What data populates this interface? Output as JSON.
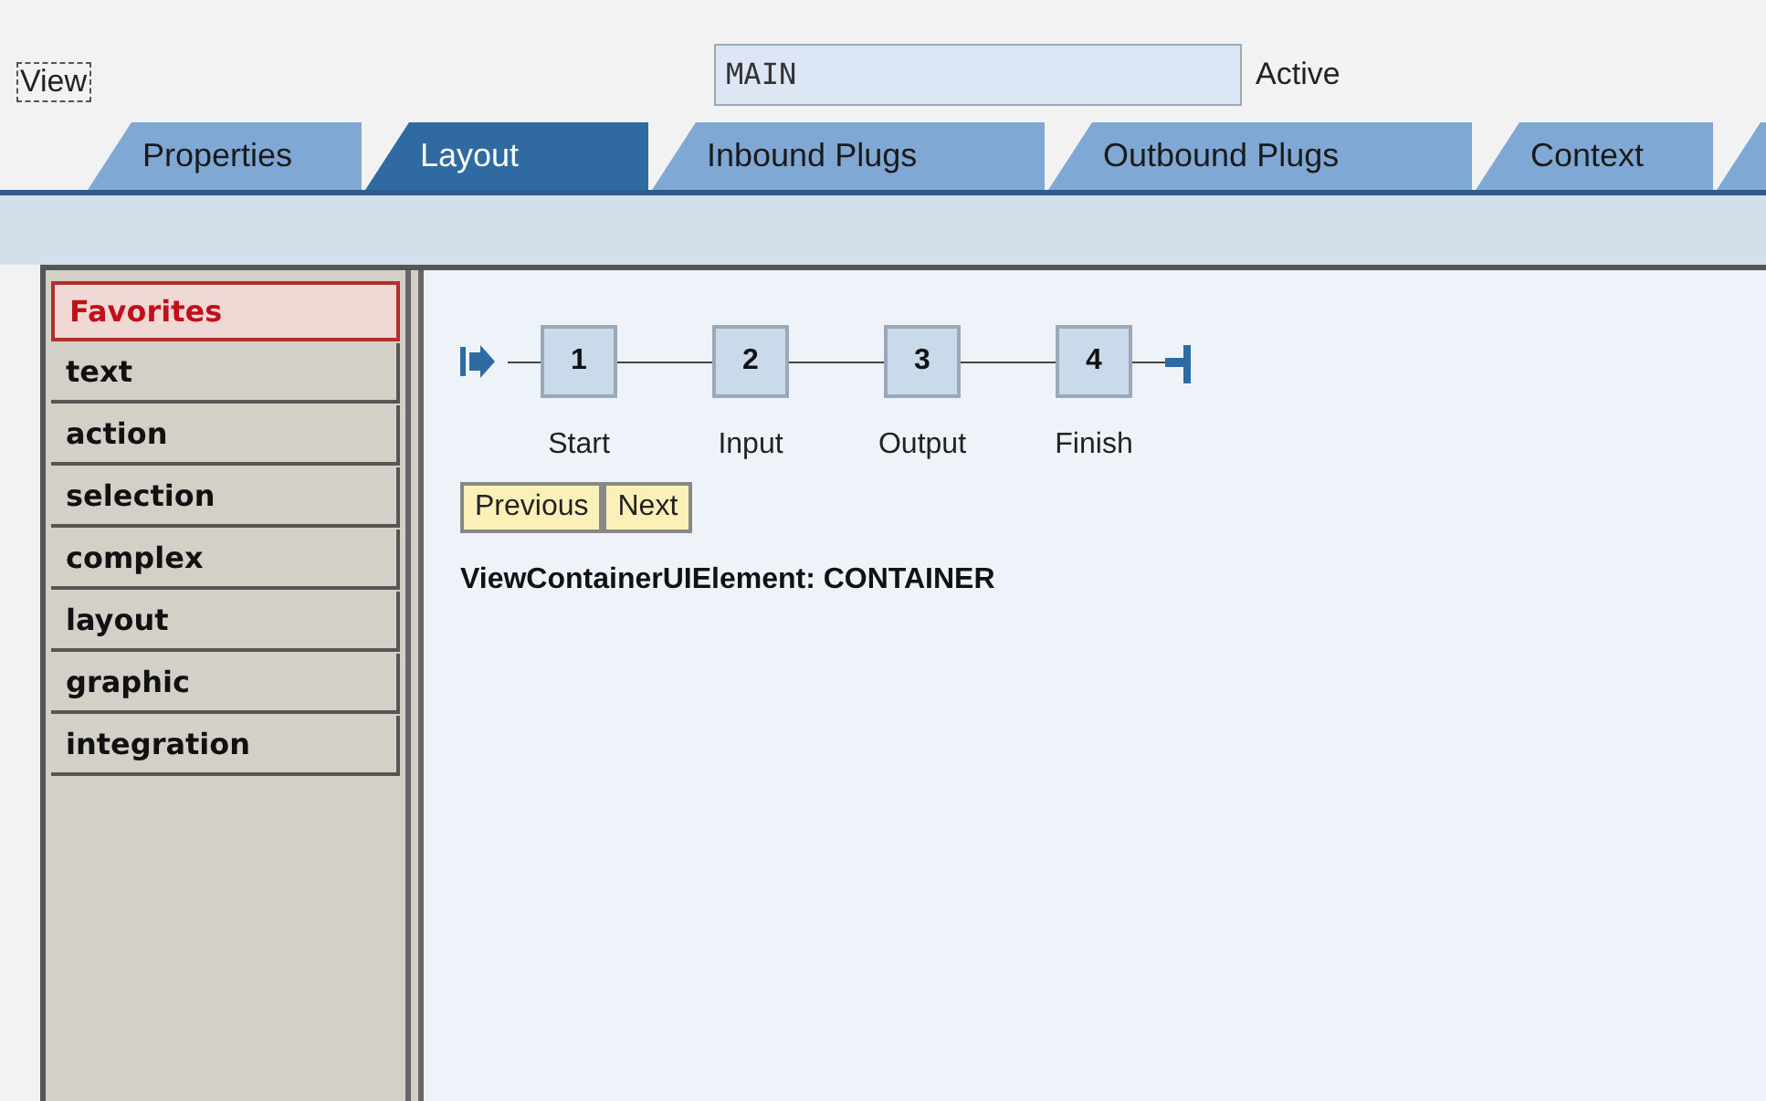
{
  "header": {
    "label": "View",
    "name_value": "MAIN",
    "status": "Active"
  },
  "tabs": [
    {
      "label": "Properties",
      "selected": false
    },
    {
      "label": "Layout",
      "selected": true
    },
    {
      "label": "Inbound Plugs",
      "selected": false
    },
    {
      "label": "Outbound Plugs",
      "selected": false
    },
    {
      "label": "Context",
      "selected": false
    }
  ],
  "palette": [
    {
      "label": "Favorites",
      "selected": true
    },
    {
      "label": "text",
      "selected": false
    },
    {
      "label": "action",
      "selected": false
    },
    {
      "label": "selection",
      "selected": false
    },
    {
      "label": "complex",
      "selected": false
    },
    {
      "label": "layout",
      "selected": false
    },
    {
      "label": "graphic",
      "selected": false
    },
    {
      "label": "integration",
      "selected": false
    }
  ],
  "road_map": [
    {
      "number": "1",
      "label": "Start"
    },
    {
      "number": "2",
      "label": "Input"
    },
    {
      "number": "3",
      "label": "Output"
    },
    {
      "number": "4",
      "label": "Finish"
    }
  ],
  "buttons": [
    "Previous",
    "Next"
  ],
  "container_label": "ViewContainerUIElement: CONTAINER"
}
